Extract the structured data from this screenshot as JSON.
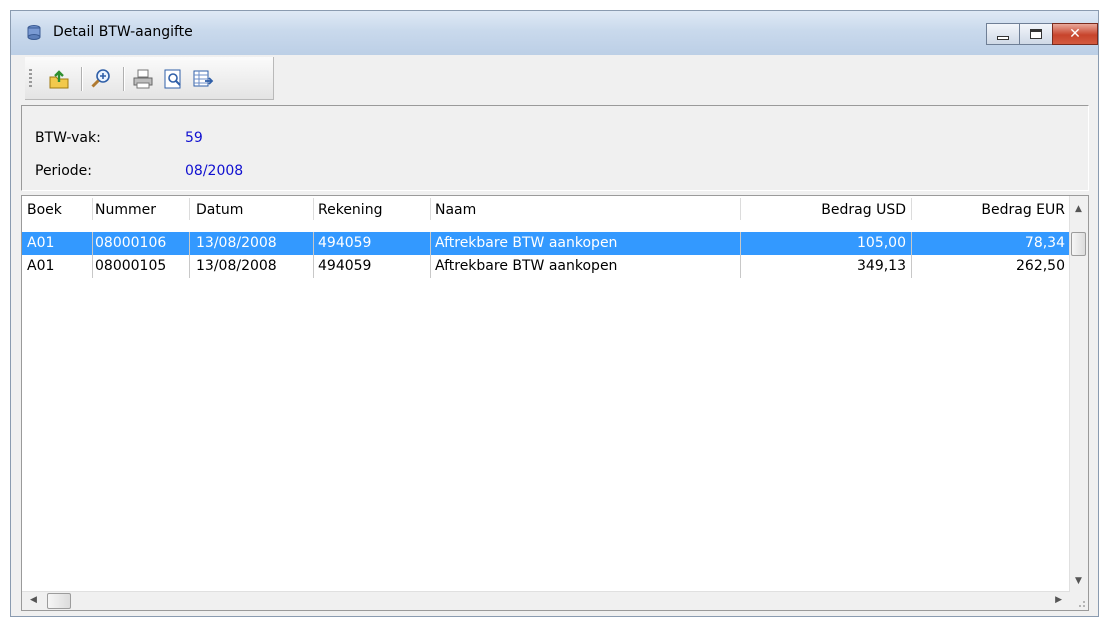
{
  "window": {
    "title": "Detail BTW-aangifte"
  },
  "info": {
    "btw_vak_label": "BTW-vak:",
    "btw_vak_value": "59",
    "periode_label": "Periode:",
    "periode_value": "08/2008"
  },
  "table": {
    "columns": [
      "Boek",
      "Nummer",
      "Datum",
      "Rekening",
      "Naam",
      "Bedrag USD",
      "Bedrag EUR"
    ],
    "rows": [
      {
        "boek": "A01",
        "nummer": "08000106",
        "datum": "13/08/2008",
        "rekening": "494059",
        "naam": "Aftrekbare BTW aankopen",
        "usd": "105,00",
        "eur": "78,34",
        "selected": true
      },
      {
        "boek": "A01",
        "nummer": "08000105",
        "datum": "13/08/2008",
        "rekening": "494059",
        "naam": "Aftrekbare BTW aankopen",
        "usd": "349,13",
        "eur": "262,50",
        "selected": false
      }
    ]
  },
  "colors": {
    "selection": "#3399ff",
    "value_text": "#1010d0"
  },
  "icons": [
    "app-db-icon",
    "export-icon",
    "zoom-icon",
    "print-icon",
    "print-preview-icon",
    "export-table-icon"
  ]
}
